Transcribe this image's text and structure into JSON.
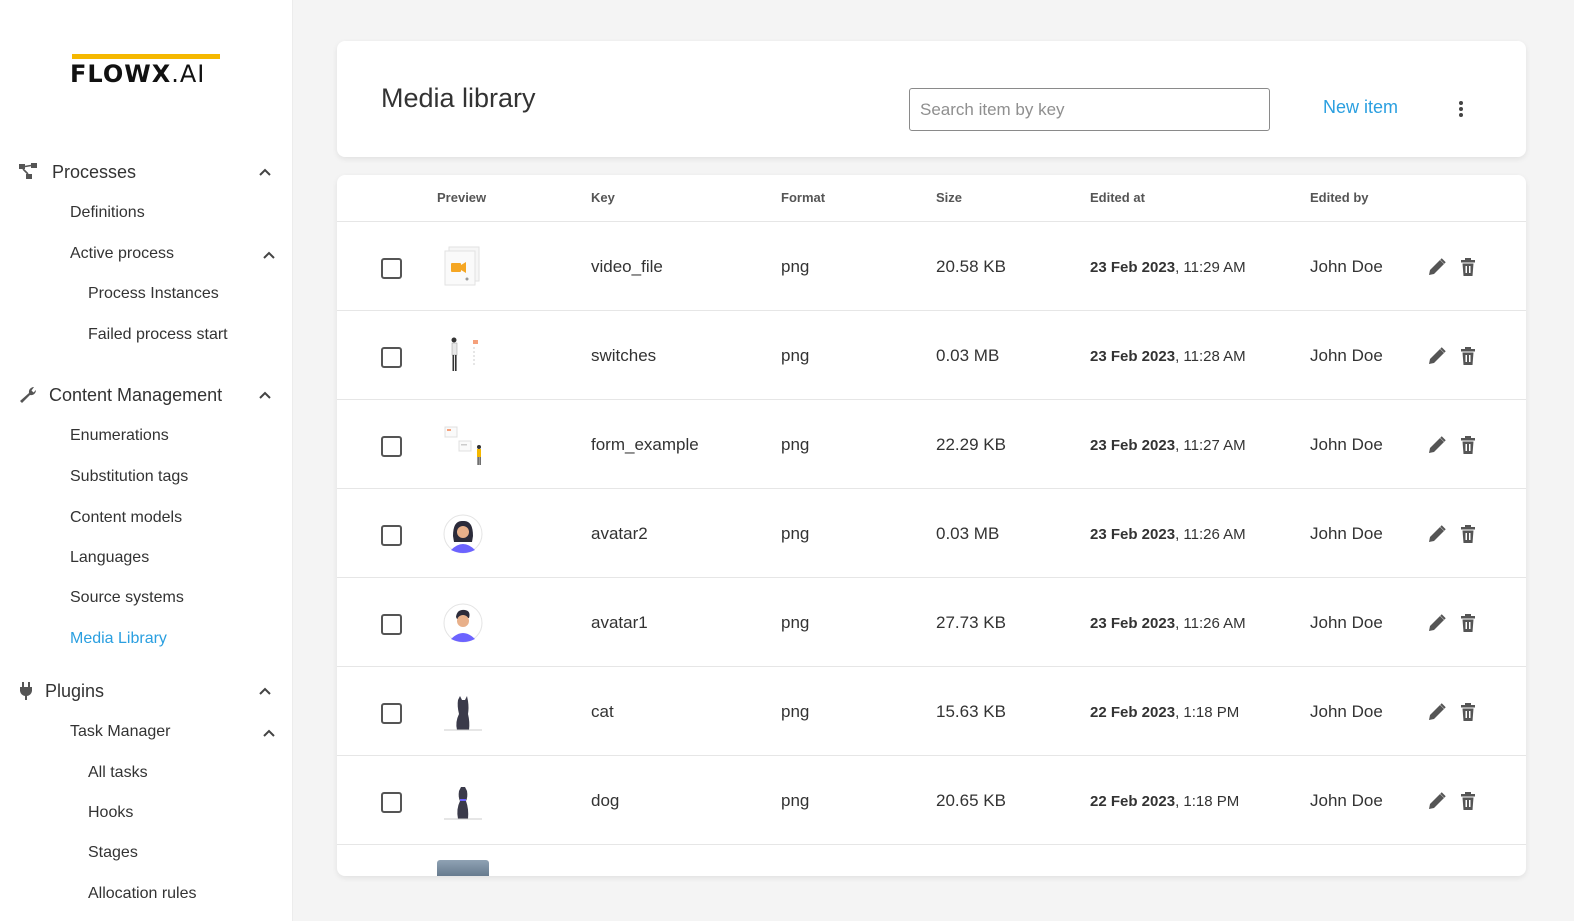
{
  "app": {
    "logo_main": "FLOWX",
    "logo_suffix": ".AI"
  },
  "sidebar": {
    "processes": {
      "label": "Processes",
      "items": {
        "definitions": "Definitions",
        "active_process": "Active process",
        "process_instances": "Process Instances",
        "failed_process_start": "Failed process start"
      }
    },
    "content_management": {
      "label": "Content Management",
      "items": {
        "enumerations": "Enumerations",
        "substitution_tags": "Substitution tags",
        "content_models": "Content models",
        "languages": "Languages",
        "source_systems": "Source systems",
        "media_library": "Media Library"
      }
    },
    "plugins": {
      "label": "Plugins",
      "items": {
        "task_manager": "Task Manager",
        "all_tasks": "All tasks",
        "hooks": "Hooks",
        "stages": "Stages",
        "allocation_rules": "Allocation rules"
      }
    },
    "active_item": "Media Library",
    "accent_color": "#2a9fe0"
  },
  "header": {
    "title": "Media library",
    "search_placeholder": "Search item by key",
    "new_item_label": "New item"
  },
  "table": {
    "columns": {
      "preview": "Preview",
      "key": "Key",
      "format": "Format",
      "size": "Size",
      "edited_at": "Edited at",
      "edited_by": "Edited by"
    },
    "rows": [
      {
        "thumb": "video-file-thumbnail",
        "key": "video_file",
        "format": "png",
        "size": "20.58 KB",
        "date": "23 Feb 2023",
        "time": ", 11:29 AM",
        "edited_by": "John Doe"
      },
      {
        "thumb": "switches-thumbnail",
        "key": "switches",
        "format": "png",
        "size": "0.03 MB",
        "date": "23 Feb 2023",
        "time": ", 11:28 AM",
        "edited_by": "John Doe"
      },
      {
        "thumb": "form-example-thumbnail",
        "key": "form_example",
        "format": "png",
        "size": "22.29 KB",
        "date": "23 Feb 2023",
        "time": ", 11:27 AM",
        "edited_by": "John Doe"
      },
      {
        "thumb": "avatar2-thumbnail",
        "key": "avatar2",
        "format": "png",
        "size": "0.03 MB",
        "date": "23 Feb 2023",
        "time": ", 11:26 AM",
        "edited_by": "John Doe"
      },
      {
        "thumb": "avatar1-thumbnail",
        "key": "avatar1",
        "format": "png",
        "size": "27.73 KB",
        "date": "23 Feb 2023",
        "time": ", 11:26 AM",
        "edited_by": "John Doe"
      },
      {
        "thumb": "cat-thumbnail",
        "key": "cat",
        "format": "png",
        "size": "15.63 KB",
        "date": "22 Feb 2023",
        "time": ", 1:18 PM",
        "edited_by": "John Doe"
      },
      {
        "thumb": "dog-thumbnail",
        "key": "dog",
        "format": "png",
        "size": "20.65 KB",
        "date": "22 Feb 2023",
        "time": ", 1:18 PM",
        "edited_by": "John Doe"
      }
    ]
  }
}
